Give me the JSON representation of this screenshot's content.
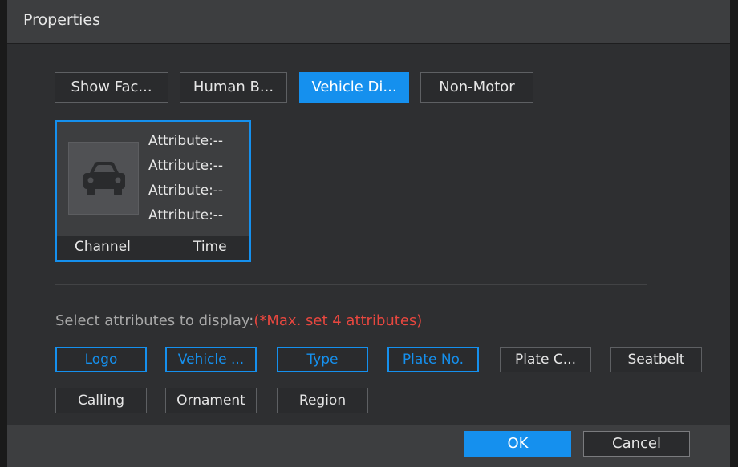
{
  "dialog": {
    "title": "Properties"
  },
  "tabs": [
    {
      "label": "Show Fac...",
      "active": false
    },
    {
      "label": "Human B...",
      "active": false
    },
    {
      "label": "Vehicle Di...",
      "active": true
    },
    {
      "label": "Non-Motor",
      "active": false
    }
  ],
  "preview": {
    "icon": "car-icon",
    "attributes": [
      "Attribute:--",
      "Attribute:--",
      "Attribute:--",
      "Attribute:--"
    ],
    "channel_label": "Channel",
    "time_label": "Time"
  },
  "attribute_select": {
    "prompt": "Select attributes to display:",
    "limit_note": "(*Max. set 4 attributes)",
    "options": [
      {
        "label": "Logo",
        "selected": true
      },
      {
        "label": "Vehicle ...",
        "selected": true
      },
      {
        "label": "Type",
        "selected": true
      },
      {
        "label": "Plate No.",
        "selected": true
      },
      {
        "label": "Plate C...",
        "selected": false
      },
      {
        "label": "Seatbelt",
        "selected": false
      },
      {
        "label": "Calling",
        "selected": false
      },
      {
        "label": "Ornament",
        "selected": false
      },
      {
        "label": "Region",
        "selected": false
      }
    ]
  },
  "buttons": {
    "ok": "OK",
    "cancel": "Cancel"
  },
  "colors": {
    "accent": "#1590ee",
    "note_red": "#e8473f",
    "background": "#2e2f31"
  }
}
